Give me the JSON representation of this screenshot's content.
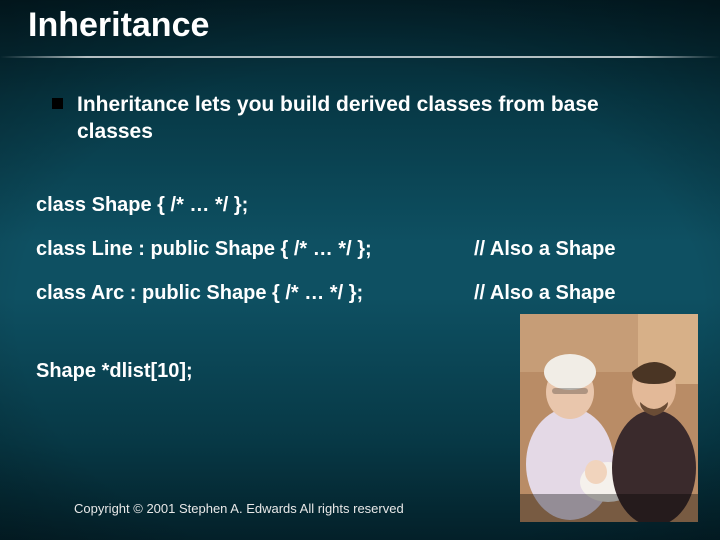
{
  "title": "Inheritance",
  "bullet": "Inheritance lets you build derived classes from base classes",
  "code": {
    "line1": "class Shape { /* … */ };",
    "line2": "class Line : public Shape { /* … */ };",
    "line3": "class Arc : public Shape { /* … */ };",
    "line4": "Shape *dlist[10];",
    "comment2": "// Also a Shape",
    "comment3": "// Also a Shape"
  },
  "footer": "Copyright © 2001 Stephen A. Edwards  All rights reserved",
  "image_alt": "Photograph of three people (elderly woman, baby, man)"
}
